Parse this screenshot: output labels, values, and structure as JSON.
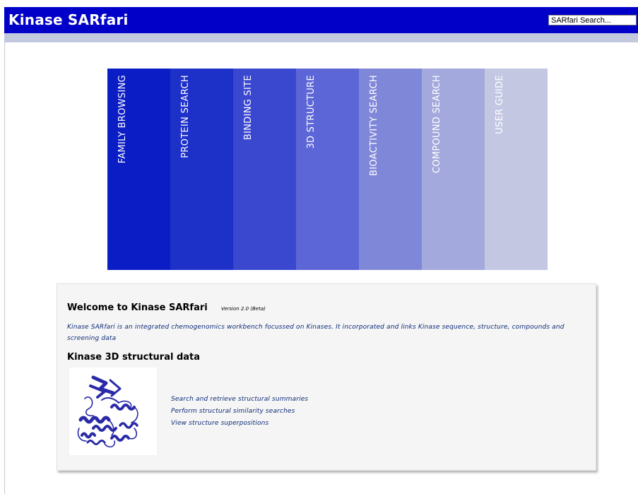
{
  "header": {
    "title": "Kinase SARfari",
    "search_value": "SARfari Search..."
  },
  "nav": {
    "items": [
      {
        "label": "FAMILY BROWSING",
        "color": "#0b1ec6"
      },
      {
        "label": "PROTEIN SEARCH",
        "color": "#1d30c8"
      },
      {
        "label": "BINDING SITE",
        "color": "#3a48d0"
      },
      {
        "label": "3D STRUCTURE",
        "color": "#5c66d6"
      },
      {
        "label": "BIOACTIVITY SEARCH",
        "color": "#7f87d8"
      },
      {
        "label": "COMPOUND SEARCH",
        "color": "#a3a9dc"
      },
      {
        "label": "USER GUIDE",
        "color": "#c3c7e2"
      }
    ]
  },
  "welcome": {
    "title": "Welcome to Kinase SARfari",
    "version": "Version 2.0 (Beta)",
    "description": "Kinase SARfari is an integrated chemogenomics workbench focussed on Kinases. It incorporated and links Kinase sequence, structure, compounds and screening data"
  },
  "structural": {
    "title": "Kinase 3D structural data",
    "image_icon": "protein-structure-ribbon-icon",
    "links": [
      "Search and retrieve structural summaries",
      "Perform structural similarity searches",
      "View structure superpositions"
    ]
  },
  "colors": {
    "header_bg": "#0000c8",
    "subbar_bg": "#c2c9df",
    "link_text": "#0e2a78",
    "ribbon": "#2a2aa8"
  }
}
